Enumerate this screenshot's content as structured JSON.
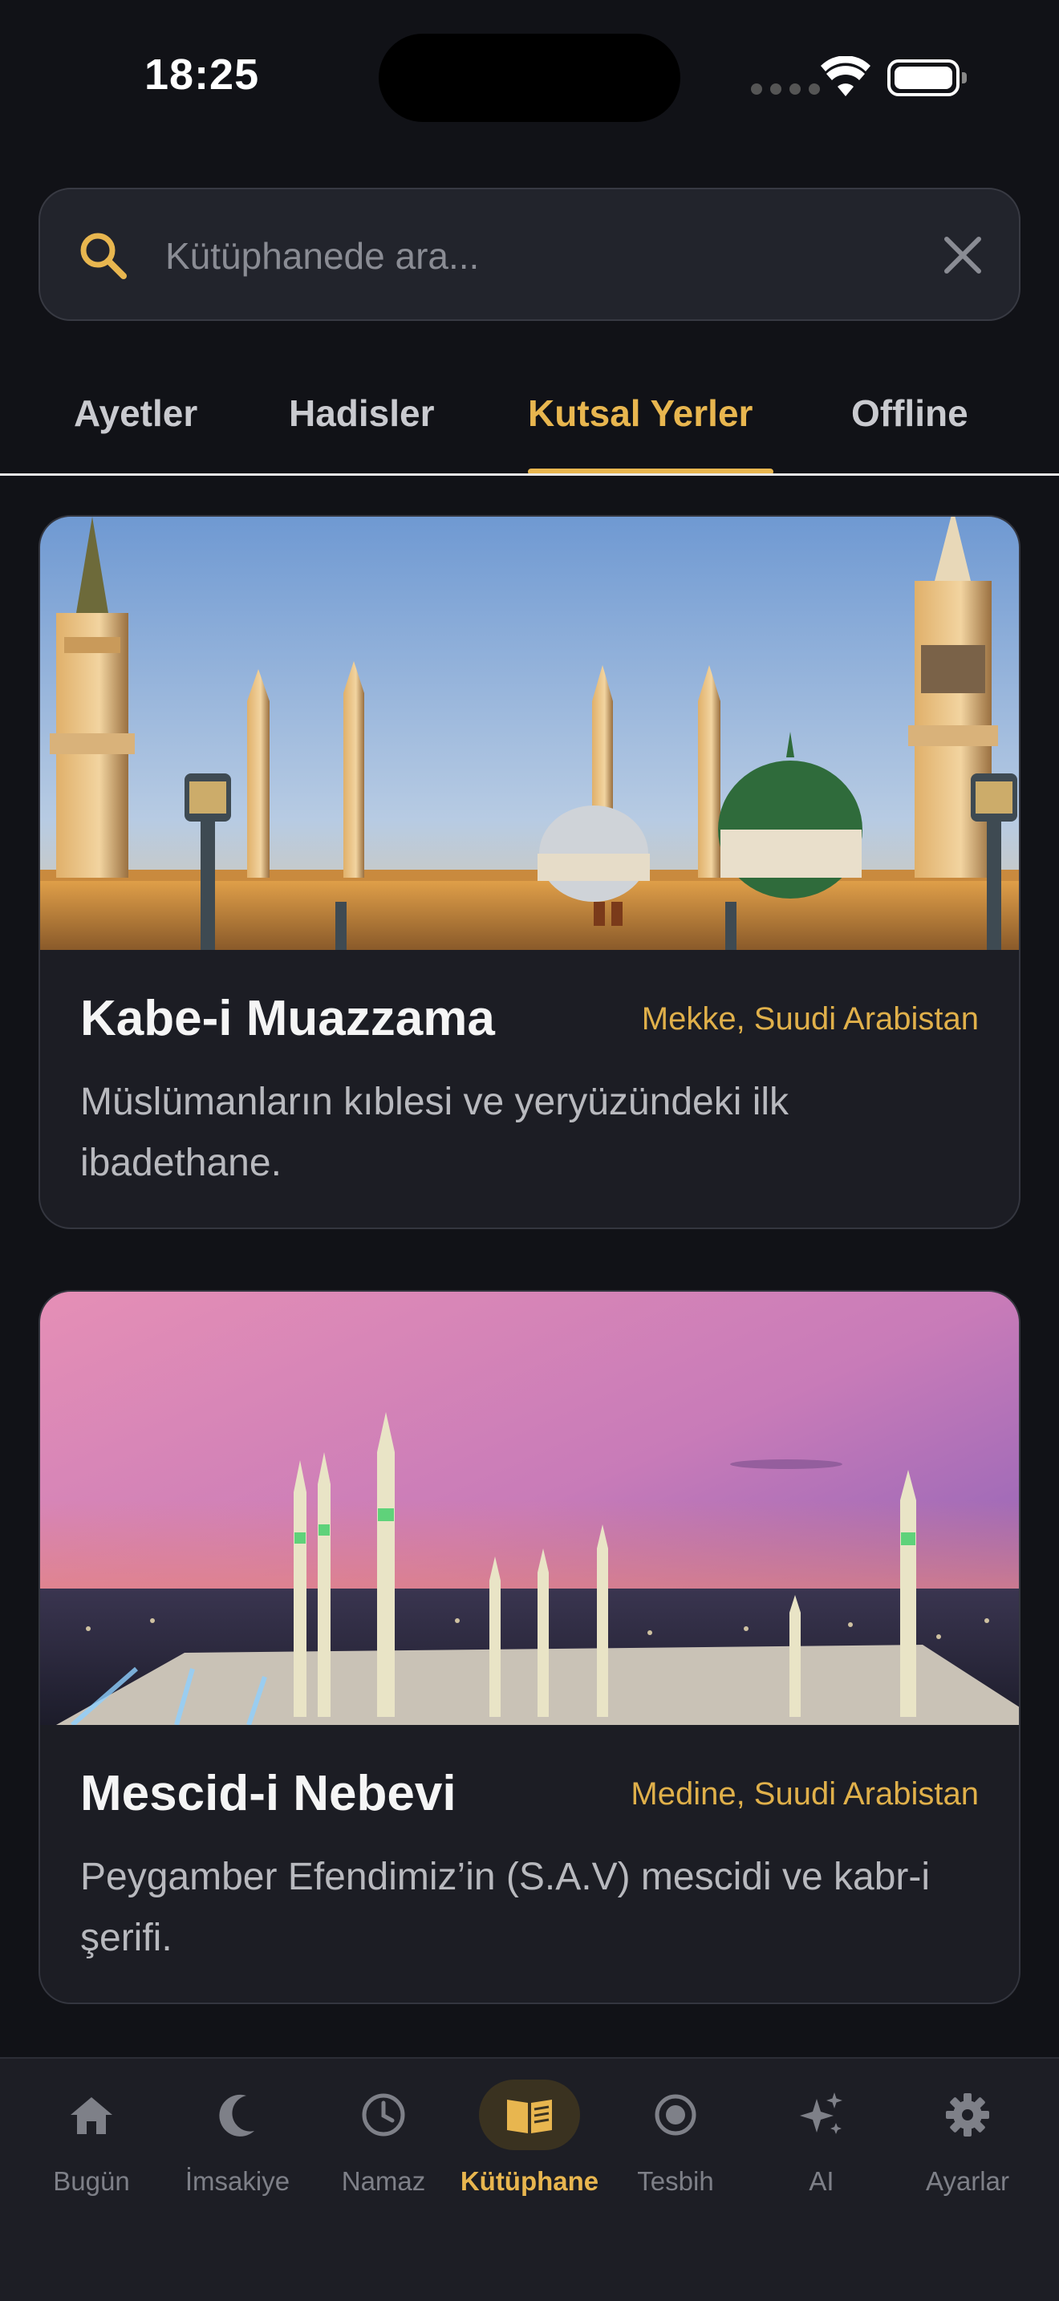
{
  "status_bar": {
    "time": "18:25"
  },
  "search": {
    "placeholder": "Kütüphanede ara...",
    "value": ""
  },
  "tabs": [
    {
      "label": "Ayetler",
      "active": false
    },
    {
      "label": "Hadisler",
      "active": false
    },
    {
      "label": "Kutsal Yerler",
      "active": true
    },
    {
      "label": "Offline",
      "active": false
    }
  ],
  "places": [
    {
      "title": "Kabe-i Muazzama",
      "location": "Mekke, Suudi Arabistan",
      "description": "Müslümanların kıblesi ve yeryüzündeki ilk ibadethane."
    },
    {
      "title": "Mescid-i Nebevi",
      "location": "Medine, Suudi Arabistan",
      "description": "Peygamber Efendimiz’in (S.A.V) mescidi ve kabr-i şerifi."
    }
  ],
  "bottom_nav": [
    {
      "label": "Bugün",
      "icon": "home-icon",
      "active": false
    },
    {
      "label": "İmsakiye",
      "icon": "crescent-moon-icon",
      "active": false
    },
    {
      "label": "Namaz",
      "icon": "clock-icon",
      "active": false
    },
    {
      "label": "Kütüphane",
      "icon": "open-book-icon",
      "active": true
    },
    {
      "label": "Tesbih",
      "icon": "prayer-beads-icon",
      "active": false
    },
    {
      "label": "AI",
      "icon": "sparkles-icon",
      "active": false
    },
    {
      "label": "Ayarlar",
      "icon": "gear-icon",
      "active": false
    }
  ],
  "colors": {
    "accent": "#e8b64f",
    "background": "#111217",
    "card": "#1c1d24"
  }
}
